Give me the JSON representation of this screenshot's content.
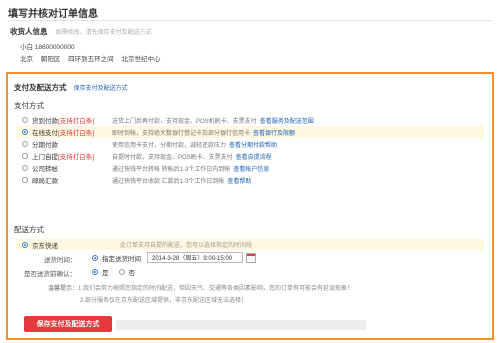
{
  "page": {
    "title": "填写并核对订单信息"
  },
  "consignee": {
    "heading": "收货人信息",
    "hint": "如需修改，请先保存支付及配送方式",
    "name_phone": "小白  18600000000",
    "address_parts": [
      "北京",
      "朝阳区",
      "四环到五环之间",
      "北京世纪中心"
    ]
  },
  "payship": {
    "heading": "支付及配送方式",
    "save_link": "保存支付及配送方式",
    "payment_title": "支付方式",
    "payments": [
      {
        "name": "货到付款",
        "option": "[支持打白条]",
        "desc": "送货上门后再付款，支持现金、POS机刷卡、支票支付",
        "link": "查看服务及配送范围",
        "selected": false
      },
      {
        "name": "在线支付",
        "option": "[支持打白条]",
        "desc": "即时到帐，支持绝大数银行借记卡及部分银行信用卡",
        "link": "查看银行及限额",
        "selected": true
      },
      {
        "name": "分期付款",
        "option": "",
        "desc": "使用信用卡支付，分期付款，减轻还款压力",
        "link": "查看分期付款帮助",
        "selected": false
      },
      {
        "name": "上门自提",
        "option": "[支持打白条]",
        "desc": "自提时付款，支持现金、POS刷卡、支票支付",
        "link": "查看自提流程",
        "selected": false
      },
      {
        "name": "公司转帐",
        "option": "",
        "desc": "通过快钱平台转帐  转帐后1-3个工作日内到帐",
        "link": "查看帐户信息",
        "selected": false
      },
      {
        "name": "邮局汇款",
        "option": "",
        "desc": "通过快钱平台收款  汇款后1-3个工作日到帐",
        "link": "查看帮助",
        "selected": false
      }
    ],
    "shipping_title": "配送方式",
    "shipping": {
      "name": "京东快递",
      "note": "此订单支持自提的配送，您可以选择指定的时间段"
    },
    "time_label": "送货时间：",
    "time_option": "指定送货时间",
    "time_value": "2014-3-28（周五）9:00-15:00",
    "confirm_label": "是否送货前确认：",
    "confirm_yes": "是",
    "confirm_no": "否",
    "tips_label": "温馨提示：",
    "tips": [
      "1.我们会努力按照您指定的时间配送，但因天气、交通等各类因素影响，您的订单有可能会有延误现象！",
      "2.部分服务仅在京东配送区域提供，非京东配送区域无法选择！"
    ],
    "save_button": "保存支付及配送方式"
  },
  "colors": {
    "accent_border": "#f38f2f",
    "button_red": "#e4393c",
    "link_blue": "#1a5fb4",
    "highlight_row": "#fff8e1"
  }
}
